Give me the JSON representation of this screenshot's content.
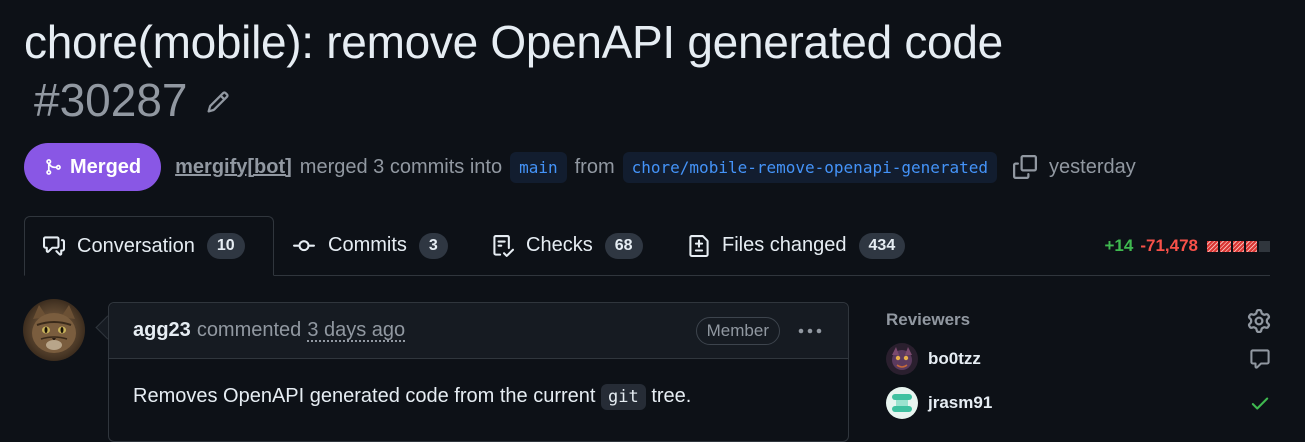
{
  "pull_request": {
    "title": "chore(mobile): remove OpenAPI generated code",
    "number": "#30287",
    "state_label": "Merged",
    "author": "mergify[bot]",
    "merge_text": "merged 3 commits into",
    "base_branch": "main",
    "from_text": "from",
    "head_branch": "chore/mobile-remove-openapi-generated",
    "time": "yesterday"
  },
  "tabs": [
    {
      "label": "Conversation",
      "count": "10",
      "icon": "conversation-icon"
    },
    {
      "label": "Commits",
      "count": "3",
      "icon": "commit-icon"
    },
    {
      "label": "Checks",
      "count": "68",
      "icon": "checklist-icon"
    },
    {
      "label": "Files changed",
      "count": "434",
      "icon": "file-diff-icon"
    }
  ],
  "diffstat": {
    "additions": "+14",
    "deletions": "-71,478"
  },
  "comment": {
    "author": "agg23",
    "action": "commented",
    "time": "3 days ago",
    "badge": "Member",
    "body_before": "Removes OpenAPI generated code from the current",
    "body_code": "git",
    "body_after": "tree."
  },
  "sidebar": {
    "reviewers_heading": "Reviewers",
    "reviewers": [
      {
        "name": "bo0tzz",
        "status": "commented",
        "icon": "comment-icon"
      },
      {
        "name": "jrasm91",
        "status": "approved",
        "icon": "check-icon"
      }
    ]
  },
  "colors": {
    "background": "#0d1117",
    "merged": "#8957e5",
    "branch_text": "#4493f8",
    "additions": "#3fb950",
    "deletions": "#f85149"
  }
}
